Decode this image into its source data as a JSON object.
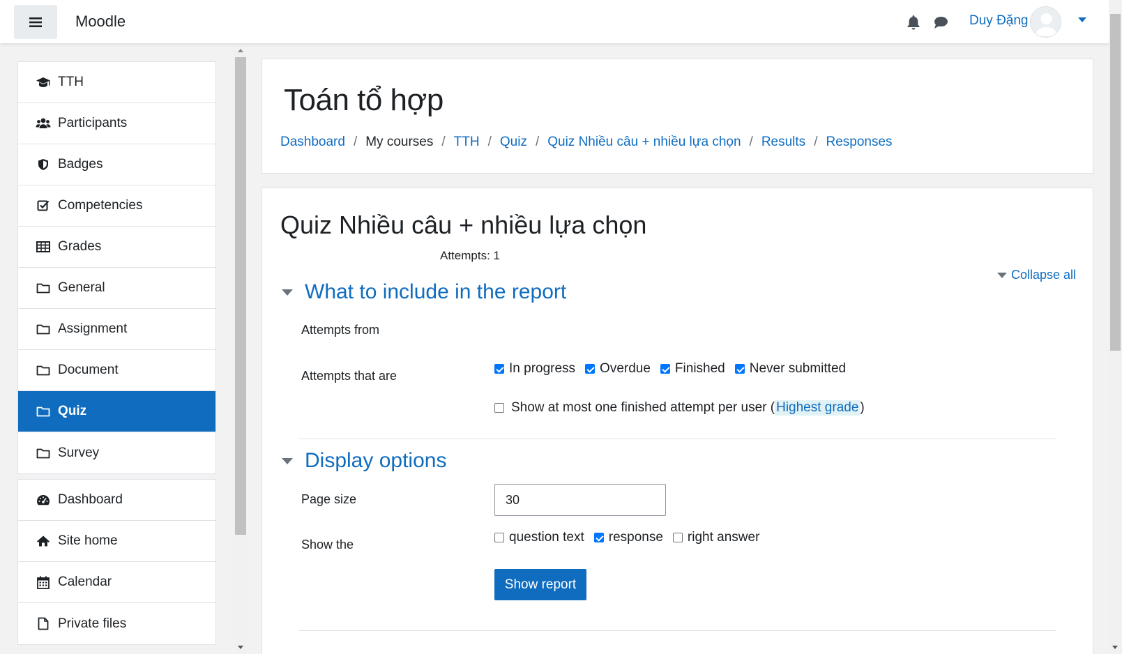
{
  "navbar": {
    "brand": "Moodle",
    "user_name": "Duy Đặng",
    "icons": [
      "menu-icon",
      "bell-icon",
      "message-icon",
      "avatar",
      "chevron-down-icon"
    ]
  },
  "drawer": {
    "course_items": [
      {
        "label": "TTH",
        "icon": "graduation-cap-icon"
      },
      {
        "label": "Participants",
        "icon": "users-icon"
      },
      {
        "label": "Badges",
        "icon": "shield-icon"
      },
      {
        "label": "Competencies",
        "icon": "checkbox-icon"
      },
      {
        "label": "Grades",
        "icon": "table-icon"
      },
      {
        "label": "General",
        "icon": "folder-icon"
      },
      {
        "label": "Assignment",
        "icon": "folder-icon"
      },
      {
        "label": "Document",
        "icon": "folder-icon"
      },
      {
        "label": "Quiz",
        "icon": "folder-icon",
        "active": true
      },
      {
        "label": "Survey",
        "icon": "folder-icon"
      }
    ],
    "site_items": [
      {
        "label": "Dashboard",
        "icon": "dashboard-icon"
      },
      {
        "label": "Site home",
        "icon": "home-icon"
      },
      {
        "label": "Calendar",
        "icon": "calendar-icon"
      },
      {
        "label": "Private files",
        "icon": "file-icon"
      }
    ]
  },
  "header": {
    "course_title": "Toán tổ hợp",
    "breadcrumb": [
      "Dashboard",
      "My courses",
      "TTH",
      "Quiz",
      "Quiz Nhiều câu + nhiều lựa chọn",
      "Results",
      "Responses"
    ]
  },
  "main": {
    "quiz_title": "Quiz Nhiều câu + nhiều lựa chọn",
    "attempts": "Attempts: 1",
    "collapse_all": "Collapse all",
    "section_report": {
      "title": "What to include in the report",
      "attempts_from_label": "Attempts from",
      "attempts_that_are_label": "Attempts that are",
      "states": [
        {
          "label": "In progress",
          "checked": true
        },
        {
          "label": "Overdue",
          "checked": true
        },
        {
          "label": "Finished",
          "checked": true
        },
        {
          "label": "Never submitted",
          "checked": true
        }
      ],
      "one_attempt_label": "Show at most one finished attempt per user (",
      "one_attempt_link": "Highest grade",
      "one_attempt_close": ")",
      "one_attempt_checked": false
    },
    "section_display": {
      "title": "Display options",
      "page_size_label": "Page size",
      "page_size_value": "30",
      "show_the_label": "Show the",
      "show_options": [
        {
          "label": "question text",
          "checked": false
        },
        {
          "label": "response",
          "checked": true
        },
        {
          "label": "right answer",
          "checked": false
        }
      ],
      "show_report_button": "Show report"
    }
  },
  "colors": {
    "accent": "#0f6cbf",
    "page_bg": "#f2f2f2",
    "checkbox_checked": "#0075ff"
  }
}
